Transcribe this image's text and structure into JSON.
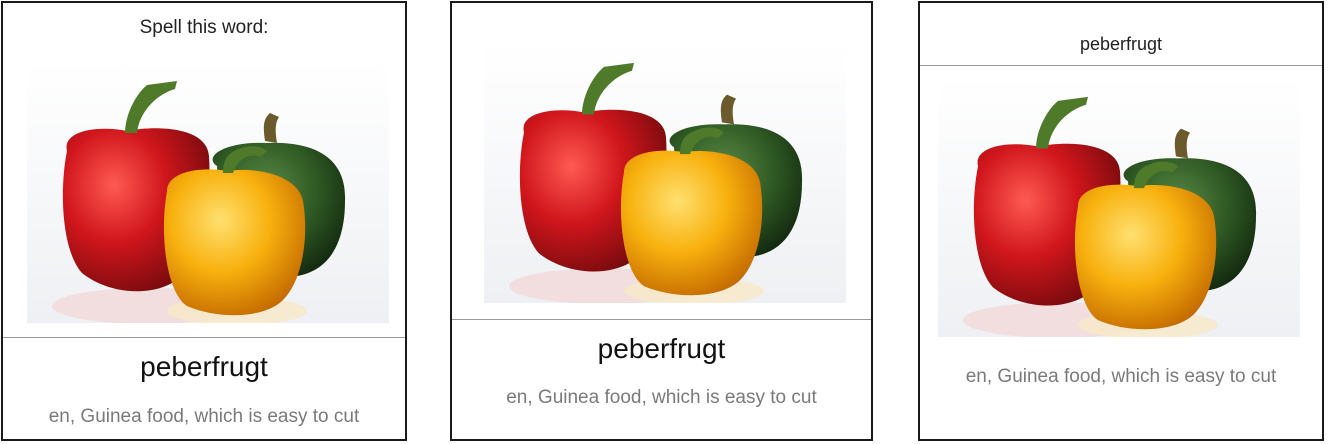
{
  "cards": [
    {
      "prompt": "Spell this word:",
      "word": "peberfrugt",
      "hint": "en, Guinea food, which is easy to cut",
      "image": "bell-peppers-image"
    },
    {
      "word": "peberfrugt",
      "hint": "en, Guinea food, which is easy to cut",
      "image": "bell-peppers-image"
    },
    {
      "word": "peberfrugt",
      "hint": "en, Guinea food, which is easy to cut",
      "image": "bell-peppers-image"
    }
  ],
  "colors": {
    "border": "#1a1a1a",
    "divider": "#9a9a9a",
    "hint_text": "#7a7a7a",
    "pepper_red": "#c8161d",
    "pepper_green": "#2f5a24",
    "pepper_yellow": "#f6a800"
  }
}
